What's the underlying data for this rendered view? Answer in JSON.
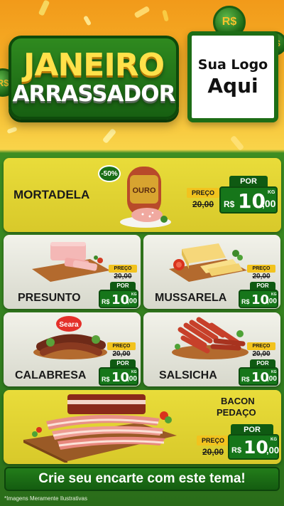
{
  "header": {
    "title_line1": "JANEIRO",
    "title_line2": "ARRASSADOR",
    "logo_line1": "Sua Logo",
    "logo_line2": "Aqui",
    "coin_symbol": "R$"
  },
  "price_labels": {
    "preco": "PREÇO",
    "por": "POR",
    "currency": "R$",
    "unit": "KG"
  },
  "products": {
    "mortadela": {
      "name": "MORTADELA",
      "old_price": "20,00",
      "price_int": "10",
      "price_cents": ",00",
      "discount": "-50%",
      "brand": "OURO"
    },
    "presunto": {
      "name": "PRESUNTO",
      "old_price": "20,00",
      "price_int": "10",
      "price_cents": ",00"
    },
    "mussarela": {
      "name": "MUSSARELA",
      "old_price": "20,00",
      "price_int": "10",
      "price_cents": ",00"
    },
    "calabresa": {
      "name": "CALABRESA",
      "old_price": "20,00",
      "price_int": "10",
      "price_cents": ",00",
      "brand": "Seara"
    },
    "salsicha": {
      "name": "SALSICHA",
      "old_price": "20,00",
      "price_int": "10",
      "price_cents": ",00"
    },
    "bacon": {
      "name_line1": "BACON",
      "name_line2": "PEDAÇO",
      "old_price": "20,00",
      "price_int": "10",
      "price_cents": ",00"
    }
  },
  "footer": {
    "cta": "Crie seu encarte com este tema!",
    "disclaimer": "*Imagens Meramente Ilustrativas"
  },
  "colors": {
    "brand_green": "#16761a",
    "dark_green": "#0f5a12",
    "yellow": "#f2c31e",
    "card_yellow": "#e9dc3a",
    "title_yellow": "#ffe14a"
  }
}
